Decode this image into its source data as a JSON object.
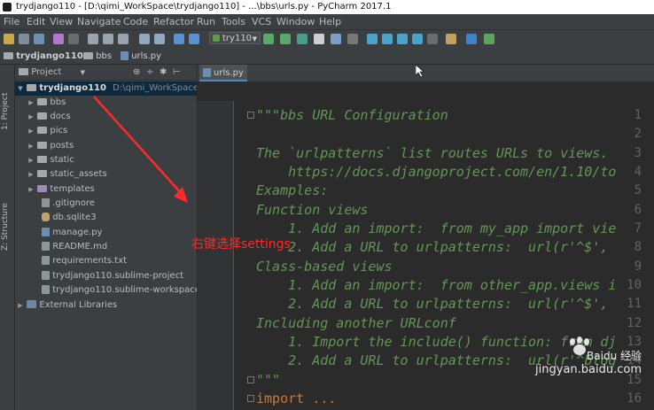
{
  "window": {
    "title": "trydjango110 - [D:\\qimi_WorkSpace\\trydjango110] - ...\\bbs\\urls.py - PyCharm 2017.1"
  },
  "menu": [
    "File",
    "Edit",
    "View",
    "Navigate",
    "Code",
    "Refactor",
    "Run",
    "Tools",
    "VCS",
    "Window",
    "Help"
  ],
  "toolbar": {
    "run_config": "try110"
  },
  "breadcrumb": {
    "project": "trydjango110",
    "folder": "bbs",
    "file": "urls.py"
  },
  "side_tabs": {
    "project": "1: Project",
    "structure": "Z: Structure"
  },
  "project_panel": {
    "header": "Project",
    "root": {
      "name": "trydjango110",
      "path": "D:\\qimi_WorkSpace\\tr"
    },
    "items": [
      {
        "label": "bbs",
        "type": "folder"
      },
      {
        "label": "docs",
        "type": "folder"
      },
      {
        "label": "pics",
        "type": "folder"
      },
      {
        "label": "posts",
        "type": "folder"
      },
      {
        "label": "static",
        "type": "folder"
      },
      {
        "label": "static_assets",
        "type": "folder"
      },
      {
        "label": "templates",
        "type": "folder"
      },
      {
        "label": ".gitignore",
        "type": "file"
      },
      {
        "label": "db.sqlite3",
        "type": "db"
      },
      {
        "label": "manage.py",
        "type": "py"
      },
      {
        "label": "README.md",
        "type": "file"
      },
      {
        "label": "requirements.txt",
        "type": "file"
      },
      {
        "label": "trydjango110.sublime-project",
        "type": "file"
      },
      {
        "label": "trydjango110.sublime-workspace",
        "type": "file"
      }
    ],
    "external": "External Libraries"
  },
  "editor": {
    "tab": "urls.py",
    "line_numbers": [
      "1",
      "2",
      "3",
      "4",
      "5",
      "6",
      "7",
      "8",
      "9",
      "10",
      "11",
      "12",
      "13",
      "14",
      "15",
      "16"
    ],
    "lines": [
      "\"\"\"bbs URL Configuration",
      "",
      "The `urlpatterns` list routes URLs to views.",
      "    https://docs.djangoproject.com/en/1.10/to",
      "Examples:",
      "Function views",
      "    1. Add an import:  from my_app import vie",
      "    2. Add a URL to urlpatterns:  url(r'^$',",
      "Class-based views",
      "    1. Add an import:  from other_app.views i",
      "    2. Add a URL to urlpatterns:  url(r'^$',",
      "Including another URLconf",
      "    1. Import the include() function: from dj",
      "    2. Add a URL to urlpatterns:  url(r'^blog",
      "\"\"\"",
      "import ..."
    ]
  },
  "annotation": "右键选择settings",
  "watermark": {
    "site": "jingyan.baidu.com",
    "brand": "Baidu 经验"
  },
  "colors": {
    "annotation": "#ff2a2a",
    "docstring": "#629755",
    "keyword": "#cc7832"
  }
}
